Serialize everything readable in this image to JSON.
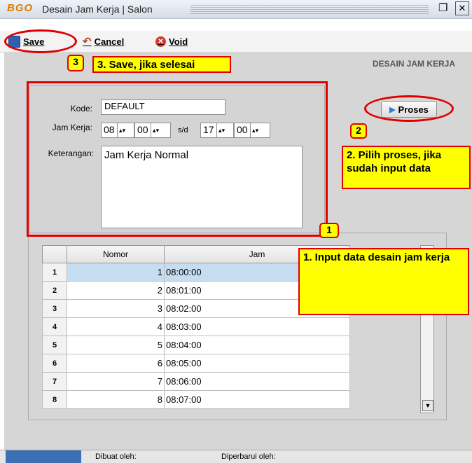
{
  "window": {
    "logo": "BGO",
    "title": "Desain Jam Kerja | Salon"
  },
  "toolbar": {
    "save_label": "Save",
    "cancel_label": "Cancel",
    "void_label": "Void"
  },
  "header": {
    "title": "DESAIN JAM KERJA"
  },
  "form": {
    "kode_label": "Kode:",
    "kode_value": "DEFAULT",
    "jam_kerja_label": "Jam Kerja:",
    "start_hour": "08",
    "start_min": "00",
    "sd_label": "s/d",
    "end_hour": "17",
    "end_min": "00",
    "keterangan_label": "Keterangan:",
    "keterangan_value": "Jam Kerja Normal",
    "proses_label": "Proses"
  },
  "grid": {
    "columns": [
      "Nomor",
      "Jam"
    ],
    "rows": [
      {
        "rn": "1",
        "nomor": "1",
        "jam": "08:00:00"
      },
      {
        "rn": "2",
        "nomor": "2",
        "jam": "08:01:00"
      },
      {
        "rn": "3",
        "nomor": "3",
        "jam": "08:02:00"
      },
      {
        "rn": "4",
        "nomor": "4",
        "jam": "08:03:00"
      },
      {
        "rn": "5",
        "nomor": "5",
        "jam": "08:04:00"
      },
      {
        "rn": "6",
        "nomor": "6",
        "jam": "08:05:00"
      },
      {
        "rn": "7",
        "nomor": "7",
        "jam": "08:06:00"
      },
      {
        "rn": "8",
        "nomor": "8",
        "jam": "08:07:00"
      }
    ]
  },
  "annotations": {
    "n1": "1",
    "n2": "2",
    "n3": "3",
    "note1": "1. Input data desain jam kerja",
    "note2": "2. Pilih proses, jika sudah input data",
    "note3": "3. Save, jika selesai"
  },
  "statusbar": {
    "dibuat": "Dibuat oleh:",
    "diperbarui": "Diperbarui oleh:"
  },
  "colors": {
    "annotation_red": "#e00000",
    "annotation_yellow": "#ffff00",
    "selection": "#c6dcf0"
  }
}
